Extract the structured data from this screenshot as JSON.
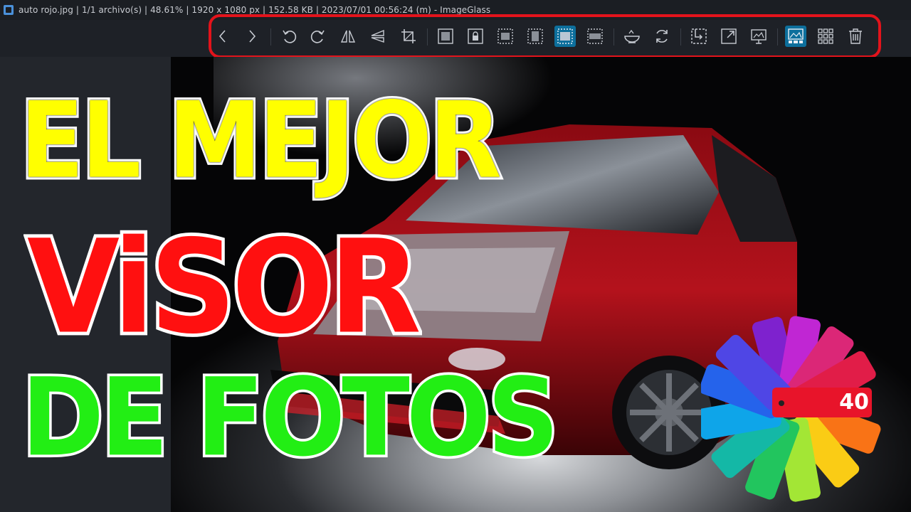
{
  "window": {
    "title": "auto rojo.jpg  |  1/1 archivo(s)  |  48.61%  |  1920 x 1080 px  |  152.58 KB  |  2023/07/01 00:56:24 (m)  - ImageGlass"
  },
  "toolbar": {
    "highlight_color": "#e3131b",
    "active_color": "#0d6f9c",
    "buttons": [
      {
        "name": "previous-image-button",
        "icon": "chevron-left-icon"
      },
      {
        "name": "next-image-button",
        "icon": "chevron-right-icon"
      },
      {
        "name": "rotate-left-button",
        "icon": "rotate-left-icon"
      },
      {
        "name": "rotate-right-button",
        "icon": "rotate-right-icon"
      },
      {
        "name": "flip-horizontal-button",
        "icon": "flip-horizontal-icon"
      },
      {
        "name": "flip-vertical-button",
        "icon": "flip-vertical-icon"
      },
      {
        "name": "crop-button",
        "icon": "crop-icon"
      },
      {
        "name": "auto-zoom-button",
        "icon": "image-icon"
      },
      {
        "name": "lock-zoom-button",
        "icon": "lock-image-icon"
      },
      {
        "name": "scale-to-width-button",
        "icon": "scale-width-icon"
      },
      {
        "name": "scale-to-height-button",
        "icon": "scale-height-icon"
      },
      {
        "name": "scale-to-fit-button",
        "icon": "scale-fit-icon",
        "active": true
      },
      {
        "name": "scale-to-fill-button",
        "icon": "scale-fill-icon"
      },
      {
        "name": "checkerboard-button",
        "icon": "bowl-icon"
      },
      {
        "name": "slideshow-button",
        "icon": "refresh-icon"
      },
      {
        "name": "open-file-button",
        "icon": "import-icon"
      },
      {
        "name": "fullscreen-button",
        "icon": "expand-icon"
      },
      {
        "name": "frameless-button",
        "icon": "presentation-icon"
      },
      {
        "name": "gallery-button",
        "icon": "gallery-icon",
        "active": true
      },
      {
        "name": "thumbnail-grid-button",
        "icon": "grid-icon"
      },
      {
        "name": "delete-button",
        "icon": "trash-icon"
      }
    ]
  },
  "overlay": {
    "line1": "EL MEJOR",
    "line2": "ViSOR",
    "line3": "DE FOTOS",
    "line1_color": "#ffff00",
    "line2_color": "#ff1010",
    "line3_color": "#22ee14"
  },
  "logo": {
    "badge_text": "40",
    "badge_color": "#e8142a"
  }
}
